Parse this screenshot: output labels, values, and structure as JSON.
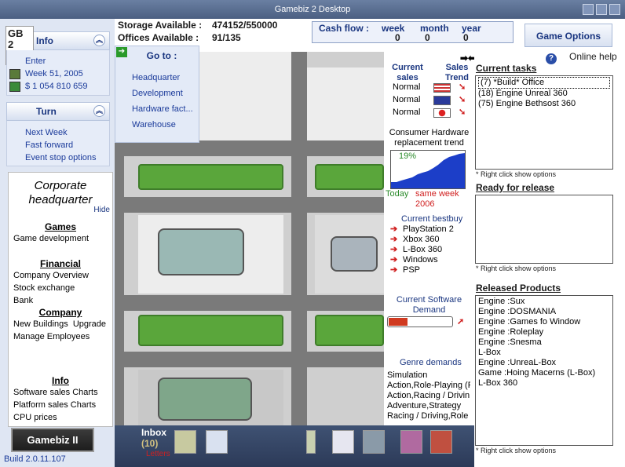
{
  "window": {
    "title": "Gamebiz 2 Desktop"
  },
  "info": {
    "logo_text": "GB 2",
    "header": "Info",
    "items": [
      "Enter",
      "Week 51, 2005",
      "$ 1 054 810 659"
    ]
  },
  "turn": {
    "header": "Turn",
    "items": [
      "Next Week",
      "Fast forward",
      "Event stop options"
    ]
  },
  "corporate": {
    "title": "Corporate headquarter",
    "hide": "Hide",
    "sections": [
      {
        "title": "Games",
        "items": [
          "Game development"
        ]
      },
      {
        "title": "Financial",
        "items": [
          "Company Overview",
          "Stock exchange",
          "Bank"
        ]
      },
      {
        "title": "Company",
        "items": [
          "New Buildings  Upgrade",
          "Manage Employees"
        ]
      },
      {
        "title": "Info",
        "items": [
          "Software sales Charts",
          "Platform sales Charts",
          "CPU prices"
        ]
      }
    ]
  },
  "bottom_left": {
    "gamebiz_button": "Gamebiz II",
    "build": "Build 2.0.11.107"
  },
  "top": {
    "storage_label": "Storage Available :",
    "storage_value": "474152/550000",
    "offices_label": "Offices Available :",
    "offices_value": "91/135"
  },
  "cashflow": {
    "label": "Cash flow :",
    "columns": [
      {
        "label": "week",
        "value": "0"
      },
      {
        "label": "month",
        "value": "0"
      },
      {
        "label": "year",
        "value": "0"
      }
    ]
  },
  "game_options": "Game Options",
  "goto": {
    "header": "Go to :",
    "items": [
      "Headquarter",
      "Development",
      "Hardware fact...",
      "Warehouse"
    ]
  },
  "sales": {
    "current_sales": "Current sales",
    "sales_trend": "Sales Trend",
    "rows": [
      {
        "status": "Normal",
        "flag": "us-flag-icon"
      },
      {
        "status": "Normal",
        "flag": "eu-flag-icon"
      },
      {
        "status": "Normal",
        "flag": "jp-flag-icon"
      }
    ]
  },
  "consumer_hw": {
    "title": "Consumer Hardware replacement trend",
    "percent": "19%",
    "today": "Today",
    "same_week": "same week",
    "year": "2006"
  },
  "bestbuy": {
    "title": "Current bestbuy",
    "items": [
      "PlayStation 2",
      "Xbox 360",
      "L-Box 360",
      "Windows",
      "PSP"
    ]
  },
  "software_demand": {
    "title": "Current Software Demand",
    "level": 0.3
  },
  "genre": {
    "title": "Genre demands",
    "items": [
      "Simulation",
      "Action,Role-Playing (R",
      "Action,Racing / Drivin",
      "Adventure,Strategy",
      "Racing / Driving,Role"
    ]
  },
  "help": {
    "online_help": "Online help",
    "icon": "?"
  },
  "current_tasks": {
    "title": "Current tasks",
    "items": [
      "(7) *Build* Office",
      "(18) Engine Unreal 360",
      "(75) Engine Bethsost 360"
    ],
    "hint": "* Right click show options"
  },
  "ready": {
    "title": "Ready for release",
    "hint": "* Right click show options"
  },
  "released": {
    "title": "Released Products",
    "items": [
      "Engine :Sux",
      "Engine :DOSMANIA",
      "Engine :Games fo Window",
      "Engine :Roleplay",
      "Engine :Snesma",
      "L-Box",
      "Engine :UnreaL-Box",
      "Game :Hoing Macerns (L-Box)",
      "L-Box 360"
    ],
    "hint": "* Right click show options"
  },
  "inbox": {
    "label": "Inbox",
    "count": "(10)",
    "letters": "Letters"
  },
  "colors": {
    "accent": "#1a3680",
    "link": "#1a3a9a",
    "warning": "#d02020"
  }
}
